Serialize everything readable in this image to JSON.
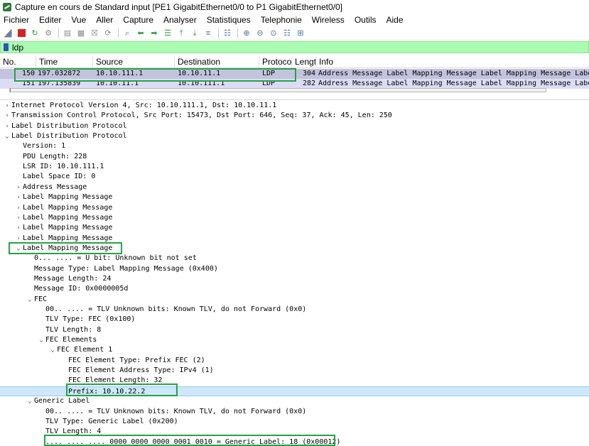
{
  "window": {
    "title": "Capture en cours de Standard input [PE1 GigabitEthernet0/0 to P1 GigabitEthernet0/0]"
  },
  "menu": [
    "Fichier",
    "Editer",
    "Vue",
    "Aller",
    "Capture",
    "Analyser",
    "Statistiques",
    "Telephonie",
    "Wireless",
    "Outils",
    "Aide"
  ],
  "toolbar": {
    "icons": [
      "shark-fin-icon",
      "stop-icon",
      "restart-icon",
      "options-gear-icon",
      "open-file-icon",
      "save-file-icon",
      "close-file-icon",
      "reload-icon",
      "find-icon",
      "go-back-icon",
      "go-forward-icon",
      "go-to-packet-icon",
      "go-first-icon",
      "go-last-icon",
      "autoscroll-icon",
      "colorize-icon",
      "zoom-in-icon",
      "zoom-out-icon",
      "zoom-normal-icon",
      "resize-columns-icon",
      "layout-icon"
    ]
  },
  "filter": {
    "value": "ldp"
  },
  "packet_list": {
    "columns": [
      "No.",
      "Time",
      "Source",
      "Destination",
      "Protocol",
      "Lengtl",
      "Info"
    ],
    "rows": [
      {
        "no": "150",
        "time": "197.032872",
        "source": "10.10.111.1",
        "destination": "10.10.11.1",
        "protocol": "LDP",
        "length": "304",
        "info": "Address Message Label Mapping Message Label Mapping Message Label M"
      },
      {
        "no": "151",
        "time": "197.135839",
        "source": "10.10.11.1",
        "destination": "10.10.111.1",
        "protocol": "LDP",
        "length": "282",
        "info": "Address Message Label Mapping Message Label Mapping Message Label M"
      }
    ]
  },
  "details": {
    "rows": [
      {
        "text": "Internet Protocol Version 4, Src: 10.10.111.1, Dst: 10.10.11.1",
        "arrow": "right"
      },
      {
        "text": "Transmission Control Protocol, Src Port: 15473, Dst Port: 646, Seq: 37, Ack: 45, Len: 250",
        "arrow": "right"
      },
      {
        "text": "Label Distribution Protocol",
        "arrow": "right"
      },
      {
        "text": "Label Distribution Protocol",
        "arrow": "down"
      },
      {
        "text": "Version: 1",
        "arrow": ""
      },
      {
        "text": "PDU Length: 228",
        "arrow": ""
      },
      {
        "text": "LSR ID: 10.10.111.1",
        "arrow": ""
      },
      {
        "text": "Label Space ID: 0",
        "arrow": ""
      },
      {
        "text": "Address Message",
        "arrow": "right"
      },
      {
        "text": "Label Mapping Message",
        "arrow": "right"
      },
      {
        "text": "Label Mapping Message",
        "arrow": "right"
      },
      {
        "text": "Label Mapping Message",
        "arrow": "right"
      },
      {
        "text": "Label Mapping Message",
        "arrow": "right"
      },
      {
        "text": "Label Mapping Message",
        "arrow": "right"
      },
      {
        "text": "Label Mapping Message",
        "arrow": "down"
      },
      {
        "text": "0... .... = U bit: Unknown bit not set",
        "arrow": ""
      },
      {
        "text": "Message Type: Label Mapping Message (0x400)",
        "arrow": ""
      },
      {
        "text": "Message Length: 24",
        "arrow": ""
      },
      {
        "text": "Message ID: 0x0000005d",
        "arrow": ""
      },
      {
        "text": "FEC",
        "arrow": "down"
      },
      {
        "text": "00.. .... = TLV Unknown bits: Known TLV, do not Forward (0x0)",
        "arrow": ""
      },
      {
        "text": "TLV Type: FEC (0x100)",
        "arrow": ""
      },
      {
        "text": "TLV Length: 8",
        "arrow": ""
      },
      {
        "text": "FEC Elements",
        "arrow": "down"
      },
      {
        "text": "FEC Element 1",
        "arrow": "down"
      },
      {
        "text": "FEC Element Type: Prefix FEC (2)",
        "arrow": ""
      },
      {
        "text": "FEC Element Address Type: IPv4 (1)",
        "arrow": ""
      },
      {
        "text": "FEC Element Length: 32",
        "arrow": ""
      },
      {
        "text": "Prefix: 10.10.22.2",
        "arrow": ""
      },
      {
        "text": "Generic Label",
        "arrow": "down"
      },
      {
        "text": "00.. .... = TLV Unknown bits: Known TLV, do not Forward (0x0)",
        "arrow": ""
      },
      {
        "text": "TLV Type: Generic Label (0x200)",
        "arrow": ""
      },
      {
        "text": "TLV Length: 4",
        "arrow": ""
      },
      {
        "text": ".... .... .... 0000 0000 0000 0001 0010 = Generic Label: 18 (0x00012)",
        "arrow": ""
      }
    ]
  },
  "colors": {
    "filter_bg": "#aafbb2",
    "selected_row": "#c3c3de",
    "ldp_row": "#dcdcf5",
    "detail_highlight": "#cce8fa",
    "annotation_box": "#25a344"
  }
}
